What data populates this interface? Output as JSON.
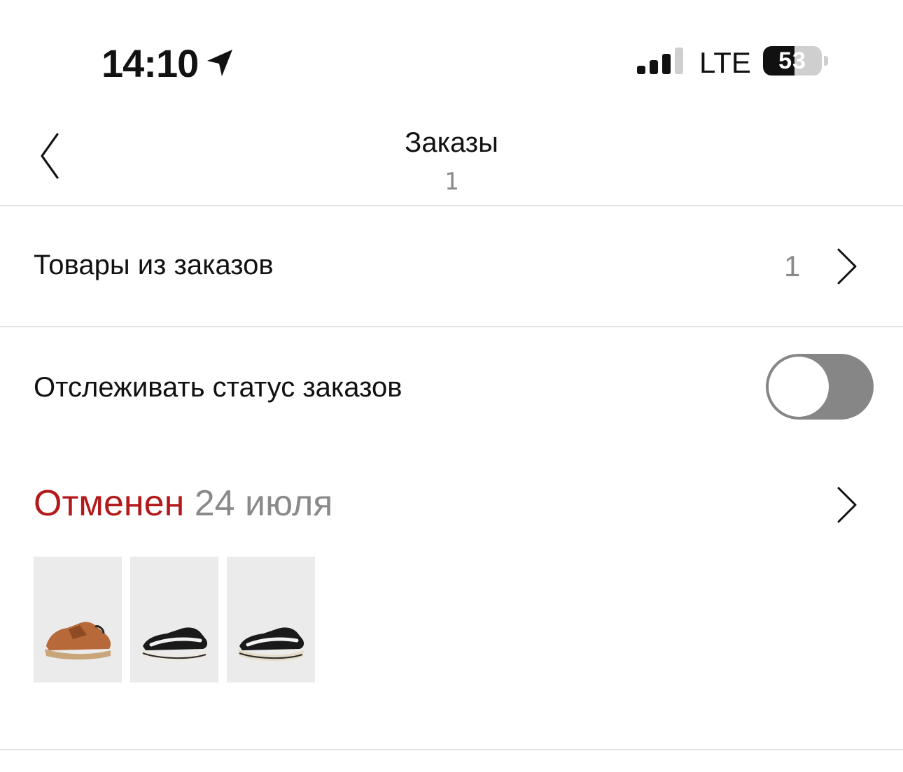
{
  "status_bar": {
    "time": "14:10",
    "network": "LTE",
    "battery_level": "53",
    "battery_percent": 53,
    "location_icon": "location-arrow-icon",
    "signal_icon": "cellular-signal-icon",
    "battery_icon": "battery-icon"
  },
  "nav": {
    "title": "Заказы",
    "count": "1",
    "back_icon": "chevron-left-icon"
  },
  "order_items_row": {
    "label": "Товары из заказов",
    "count": "1",
    "icon": "chevron-right-icon"
  },
  "tracking_row": {
    "label": "Отслеживать статус заказов",
    "toggle_on": false
  },
  "order": {
    "status": "Отменен",
    "day": "24",
    "month": "июля",
    "status_color": "#b3191b",
    "icon": "chevron-right-icon",
    "products": [
      {
        "icon": "sneaker-brown-icon",
        "color": "#b8693a"
      },
      {
        "icon": "sneaker-black-icon",
        "color": "#1a1a1a"
      },
      {
        "icon": "sneaker-black-icon",
        "color": "#1a1a1a"
      }
    ]
  },
  "colors": {
    "accent_red": "#b3191b",
    "secondary_text": "#8a8a8a",
    "divider": "#e2e2e2",
    "toggle_off": "#868686"
  }
}
